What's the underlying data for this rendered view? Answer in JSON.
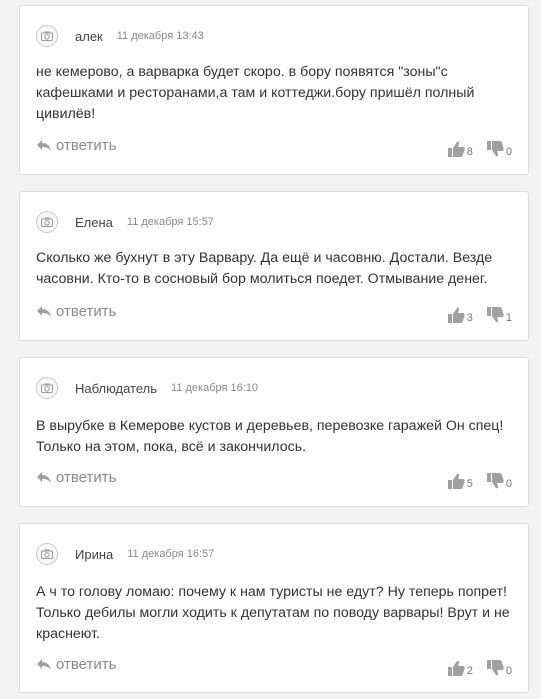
{
  "comments": [
    {
      "author": "алек",
      "date": "11 декабря 13:43",
      "text": "не кемерово, а варварка будет скоро. в бору появятся \"зоны\"с кафешками и ресторанами,а там и коттеджи.бору пришёл полный цивилёв!",
      "reply_label": "ответить",
      "likes": "8",
      "dislikes": "0"
    },
    {
      "author": "Елена",
      "date": "11 декабря 15:57",
      "text": "Сколько же бухнут в эту Варвару. Да ещё и часовню. Достали. Везде часовни. Кто-то в сосновый бор молиться поедет. Отмывание денег.",
      "reply_label": "ответить",
      "likes": "3",
      "dislikes": "1"
    },
    {
      "author": "Наблюдатель",
      "date": "11 декабря 16:10",
      "text": "В вырубке в Кемерове кустов и деревьев, перевозке гаражей Он спец! Только на этом, пока, всё и закончилось.",
      "reply_label": "ответить",
      "likes": "5",
      "dislikes": "0"
    },
    {
      "author": "Ирина",
      "date": "11 декабря 16:57",
      "text": "А ч то голову ломаю: почему к нам туристы не едут? Ну теперь попрет! Только дебилы могли ходить к депутатам по поводу варвары! Врут и не краснеют.",
      "reply_label": "ответить",
      "likes": "2",
      "dislikes": "0"
    }
  ]
}
